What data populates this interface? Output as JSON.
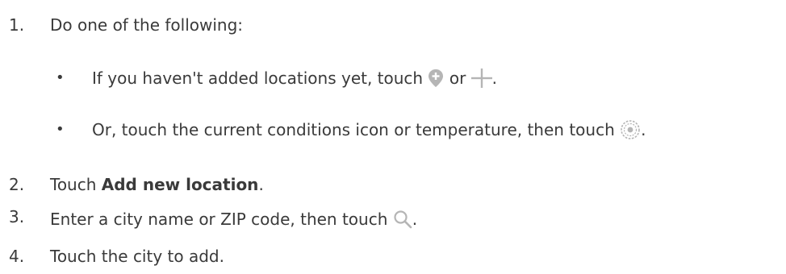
{
  "steps": [
    {
      "number": "1.",
      "text": "Do one of the following:",
      "bullets": [
        {
          "bullet": "•",
          "before": "If you haven't added locations yet, touch",
          "middle": "or",
          "after": ".",
          "icons": [
            "add-location-pin-icon",
            "plus-icon"
          ]
        },
        {
          "bullet": "•",
          "before": "Or, touch the current conditions icon or temperature, then touch",
          "after": ".",
          "icons": [
            "settings-gear-icon"
          ]
        }
      ]
    },
    {
      "number": "2.",
      "before": "Touch",
      "bold": "Add new location",
      "after": "."
    },
    {
      "number": "3.",
      "before": "Enter a city name or ZIP code, then touch",
      "after": ".",
      "icons": [
        "search-icon"
      ]
    },
    {
      "number": "4.",
      "text": "Touch the city to add."
    }
  ],
  "colors": {
    "text": "#3a3a3a",
    "icon": "#b5b5b5"
  }
}
